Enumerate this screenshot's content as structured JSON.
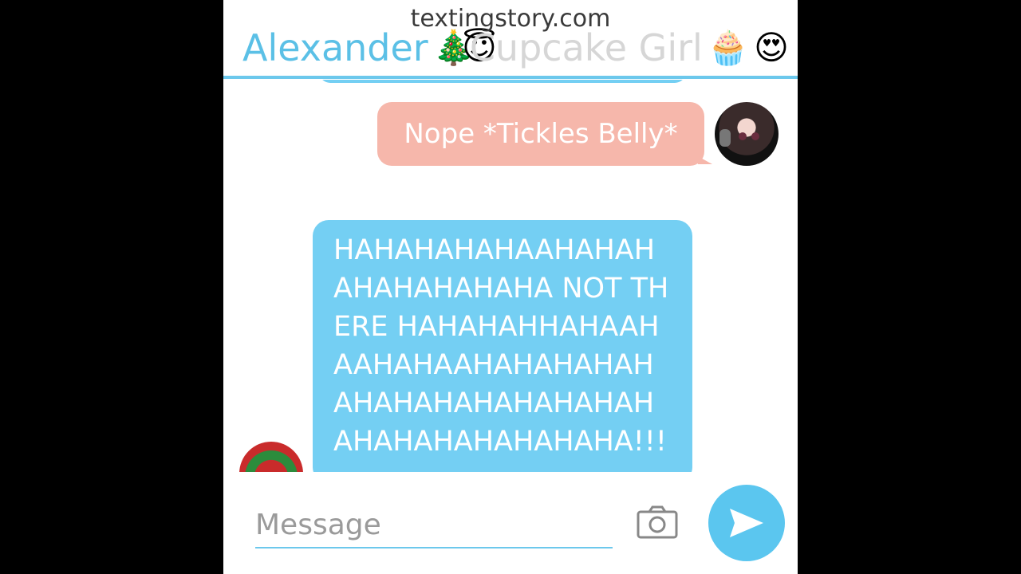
{
  "watermark": "textingstory.com",
  "header": {
    "contact_name": "Alexander",
    "contact_emoji": "🎄",
    "overlap_emoji": "😇",
    "group_name": "Cupcake Girl",
    "cupcake_emoji": "🧁",
    "heart_eyes_emoji": "😍"
  },
  "messages": [
    {
      "side": "outgoing",
      "text": "Nope *Tickles Belly*"
    },
    {
      "side": "incoming",
      "text": "HAHAHAHAHAAHAHAHAHAHAHAHAHA NOT THERE HAHAHAHHAHAAHAAHAHAAHAHAHAHAHAHAHAHAHAHAHAHAHAHAHAHAHAHAHAHA!!!"
    }
  ],
  "composer": {
    "placeholder": "Message"
  },
  "icons": [
    "camera-icon",
    "send-icon"
  ],
  "colors": {
    "accent": "#5bc6ef",
    "incoming_bubble": "#74cff3",
    "outgoing_bubble": "#f6b7ab"
  }
}
